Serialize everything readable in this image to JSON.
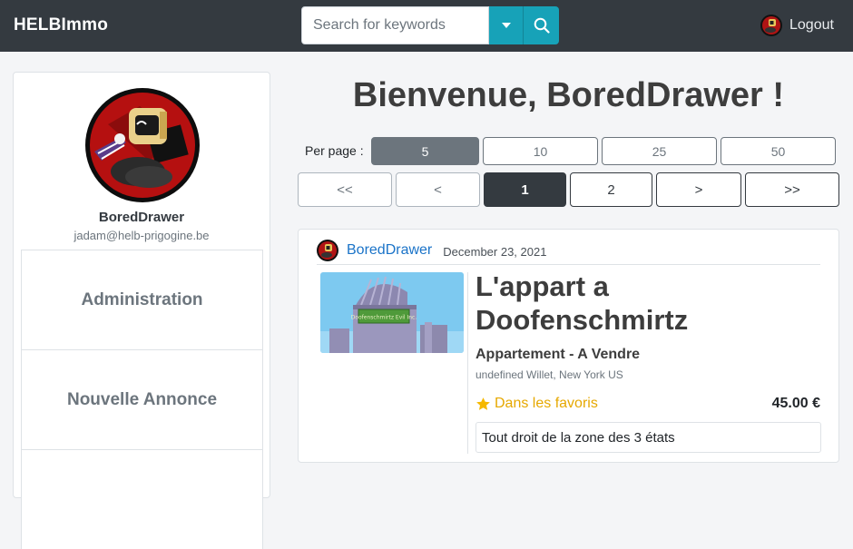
{
  "navbar": {
    "brand": "HELBImmo",
    "search_placeholder": "Search for keywords",
    "logout_label": "Logout"
  },
  "sidebar": {
    "username": "BoredDrawer",
    "email": "jadam@helb-prigogine.be",
    "menu": [
      {
        "label": "Administration"
      },
      {
        "label": "Nouvelle Annonce"
      },
      {
        "label": ""
      }
    ]
  },
  "main": {
    "welcome": "Bienvenue, BoredDrawer !",
    "per_page_label": "Per page :",
    "per_page_options": [
      "5",
      "10",
      "25",
      "50"
    ],
    "per_page_selected": "5",
    "pagination": [
      "<<",
      "<",
      "1",
      "2",
      ">",
      ">>"
    ],
    "current_page": "1"
  },
  "listing": {
    "author": "BoredDrawer",
    "date": "December 23, 2021",
    "title": "L'appart a Doofenschmirtz",
    "type": "Appartement - A Vendre",
    "address": "undefined Willet, New York US",
    "favorite_label": "Dans les favoris",
    "price": "45.00 €",
    "description": "Tout droit de la zone des 3 états",
    "thumb_sign": "Doofenschmirtz Evil Inc."
  },
  "colors": {
    "navbar": "#343a40",
    "search_button": "#17a2b8",
    "link": "#1a73c8",
    "favorite": "#e6a800"
  },
  "icons": [
    "caret-down-icon",
    "search-icon",
    "user-avatar-icon",
    "star-icon"
  ]
}
